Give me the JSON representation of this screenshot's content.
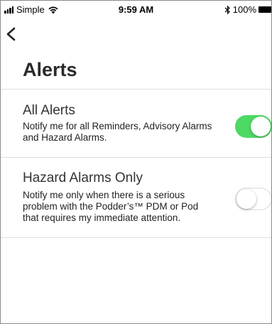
{
  "status_bar": {
    "carrier": "Simple",
    "time": "9:59 AM",
    "battery": "100%"
  },
  "header": {
    "title": "Alerts"
  },
  "options": [
    {
      "title": "All Alerts",
      "description": "Notify me for all Reminders, Advisory Alarms and Hazard Alarms.",
      "enabled": true
    },
    {
      "title": "Hazard Alarms Only",
      "description": "Notify me only when there is a serious problem with the Podder’s™ PDM or Pod that requires my immediate attention.",
      "enabled": false
    }
  ],
  "colors": {
    "toggle_on": "#4cd964",
    "divider": "#dedede"
  }
}
